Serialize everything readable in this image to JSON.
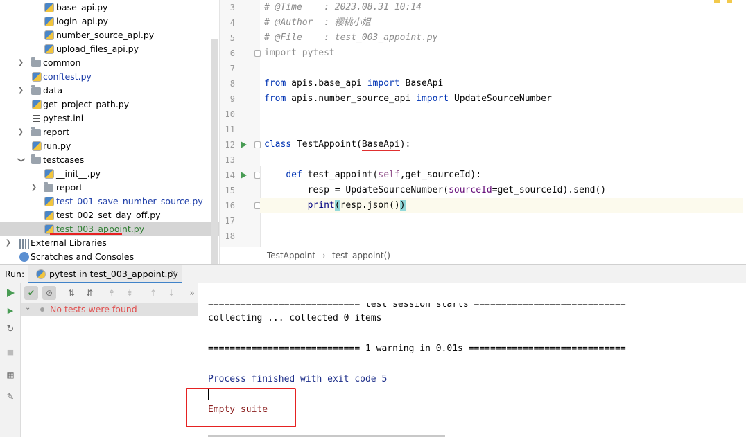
{
  "project_tree": {
    "items": [
      {
        "label": "base_api.py",
        "icon": "python-file-icon",
        "style": "normal"
      },
      {
        "label": "login_api.py",
        "icon": "python-file-icon",
        "style": "normal"
      },
      {
        "label": "number_source_api.py",
        "icon": "python-file-icon",
        "style": "normal"
      },
      {
        "label": "upload_files_api.py",
        "icon": "python-file-icon",
        "style": "normal"
      },
      {
        "label": "common",
        "icon": "package-folder-icon",
        "style": "normal",
        "expand": "collapsed"
      },
      {
        "label": "conftest.py",
        "icon": "python-file-icon",
        "style": "blue"
      },
      {
        "label": "data",
        "icon": "folder-icon",
        "style": "normal",
        "expand": "collapsed"
      },
      {
        "label": "get_project_path.py",
        "icon": "python-file-icon",
        "style": "normal"
      },
      {
        "label": "pytest.ini",
        "icon": "ini-file-icon",
        "style": "normal"
      },
      {
        "label": "report",
        "icon": "folder-icon",
        "style": "normal",
        "expand": "collapsed"
      },
      {
        "label": "run.py",
        "icon": "python-file-icon",
        "style": "normal"
      },
      {
        "label": "testcases",
        "icon": "package-folder-icon",
        "style": "normal",
        "expand": "expanded"
      },
      {
        "label": "__init__.py",
        "icon": "python-file-icon",
        "style": "normal"
      },
      {
        "label": "report",
        "icon": "folder-icon",
        "style": "normal",
        "expand": "collapsed"
      },
      {
        "label": "test_001_save_number_source.py",
        "icon": "python-file-icon",
        "style": "blue"
      },
      {
        "label": "test_002_set_day_off.py",
        "icon": "python-file-icon",
        "style": "normal"
      },
      {
        "label": "test_003_appoint.py",
        "icon": "python-file-icon",
        "style": "green",
        "selected": true
      },
      {
        "label": "External Libraries",
        "icon": "library-icon",
        "style": "normal",
        "expand": "collapsed"
      },
      {
        "label": "Scratches and Consoles",
        "icon": "scratches-icon",
        "style": "normal"
      }
    ]
  },
  "editor": {
    "line_numbers": [
      "3",
      "4",
      "5",
      "6",
      "7",
      "8",
      "9",
      "10",
      "11",
      "12",
      "13",
      "14",
      "15",
      "16",
      "17",
      "18"
    ],
    "lines": {
      "l3_comment": "# @Time    : 2023.08.31 10:14",
      "l4_comment": "# @Author  : 樱桃小姐",
      "l5_comment": "# @File    : test_003_appoint.py",
      "l6_kw": "import",
      "l6_rest": " pytest",
      "l8_kw1": "from",
      "l8_mid": " apis.base_api ",
      "l8_kw2": "import",
      "l8_rest": " BaseApi",
      "l9_kw1": "from",
      "l9_mid": " apis.number_source_api ",
      "l9_kw2": "import",
      "l9_rest": " UpdateSourceNumber",
      "l12_kw": "class",
      "l12_name": " TestAppoint(",
      "l12_base": "BaseApi",
      "l12_end": "):",
      "l14_indent": "    ",
      "l14_kw": "def",
      "l14_name": " test_appoint(",
      "l14_self": "self",
      "l14_rest": ",get_sourceId):",
      "l15_pre": "        resp = UpdateSourceNumber(",
      "l15_param": "sourceId",
      "l15_rest": "=get_sourceId).send()",
      "l16_indent": "        ",
      "l16_print": "print",
      "l16_open": "(",
      "l16_mid": "resp.json()",
      "l16_close": ")"
    },
    "breadcrumb": {
      "class_name": "TestAppoint",
      "separator": "›",
      "method": "test_appoint()"
    }
  },
  "run_panel": {
    "label": "Run:",
    "tab_title": "pytest in test_003_appoint.py",
    "tab_close": "×",
    "test_tree_root": "No tests were found",
    "console_lines": {
      "session": "============================ test session starts ============================",
      "collecting": "collecting ... collected 0 items",
      "warning": "============================ 1 warning in 0.01s =============================",
      "process": "Process finished with exit code 5",
      "empty": "Empty suite"
    }
  },
  "colors": {
    "keyword": "#0033b3",
    "comment": "#8c8c8c",
    "run_green": "#499c54",
    "no_tests_red": "#e05050",
    "annotation_red": "#e52222",
    "tab_underline": "#4083c9"
  }
}
